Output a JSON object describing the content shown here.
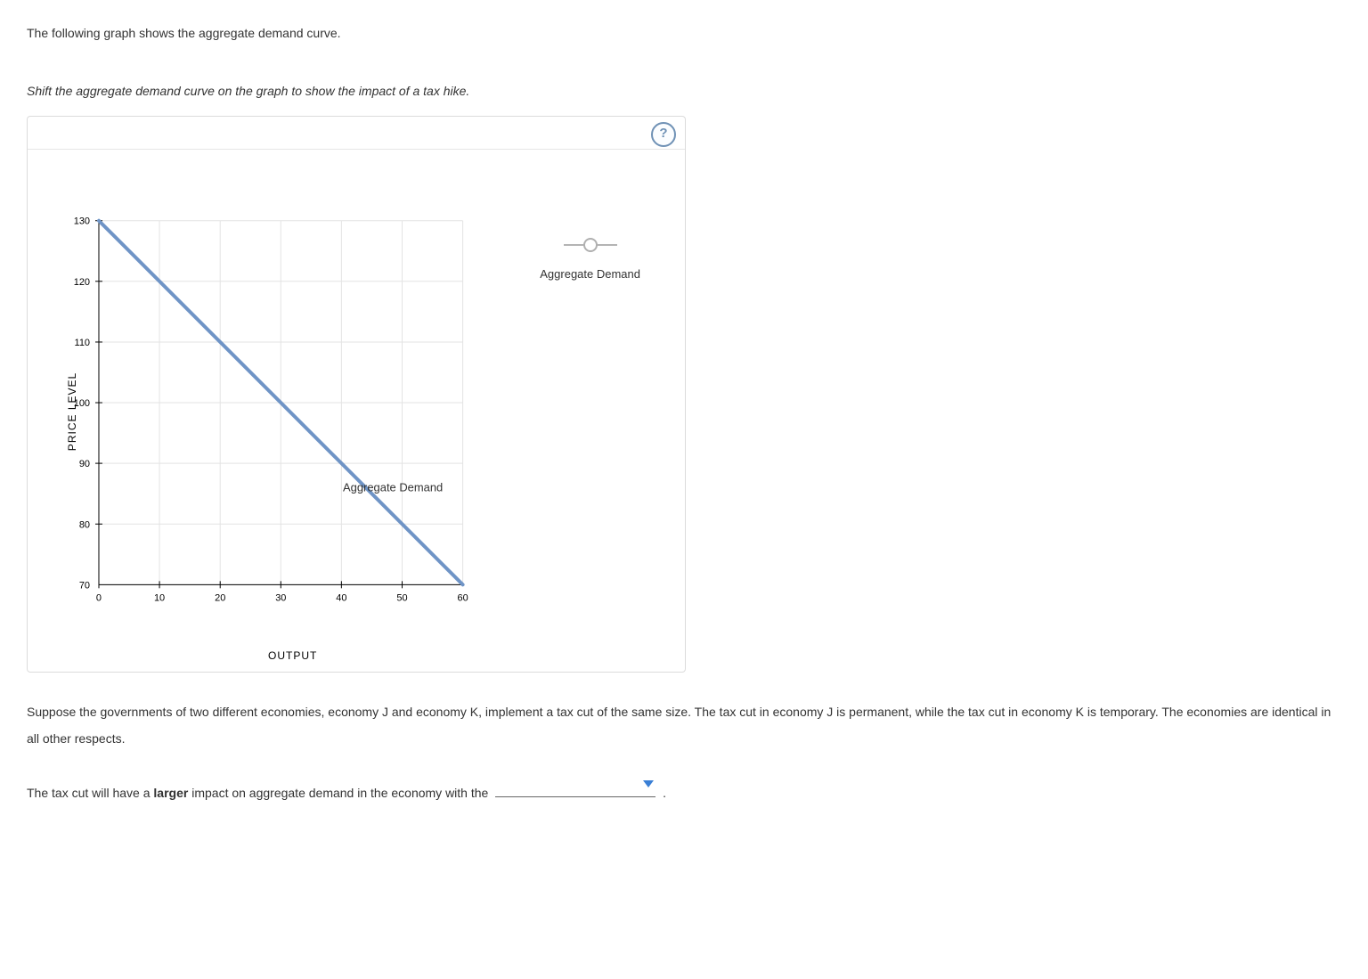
{
  "intro": "The following graph shows the aggregate demand curve.",
  "instruction": "Shift the aggregate demand curve on the graph to show the impact of a tax hike.",
  "help_label": "?",
  "chart_data": {
    "type": "line",
    "title": "",
    "xlabel": "OUTPUT",
    "ylabel": "PRICE LEVEL",
    "x_ticks": [
      0,
      10,
      20,
      30,
      40,
      50,
      60
    ],
    "y_ticks": [
      70,
      80,
      90,
      100,
      110,
      120,
      130
    ],
    "xlim": [
      0,
      60
    ],
    "ylim": [
      70,
      130
    ],
    "series": [
      {
        "name": "Aggregate Demand",
        "color": "#6f94c6",
        "x": [
          0,
          60
        ],
        "y": [
          130,
          70
        ]
      }
    ],
    "curve_annotation": "Aggregate Demand",
    "legend_label": "Aggregate Demand"
  },
  "paragraph2": "Suppose the governments of two different economies, economy J and economy K, implement a tax cut of the same size. The tax cut in economy J is permanent, while the tax cut in economy K is temporary. The economies are identical in all other respects.",
  "fill_sentence_prefix": "The tax cut will have a ",
  "fill_sentence_bold": "larger",
  "fill_sentence_mid": " impact on aggregate demand in the economy with the ",
  "fill_sentence_suffix": " .",
  "dropdown_value": ""
}
